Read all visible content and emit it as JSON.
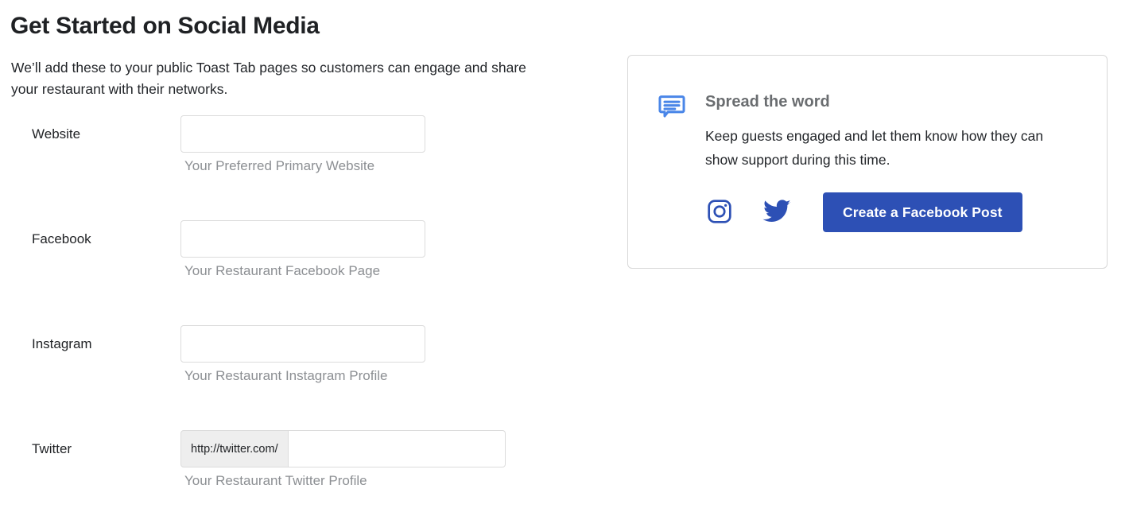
{
  "page": {
    "title": "Get Started on Social Media",
    "intro": "We’ll add these to your public Toast Tab pages so customers can engage and share your restaurant with their networks."
  },
  "form": {
    "fields": [
      {
        "label": "Website",
        "value": "",
        "placeholder": "",
        "helper": "Your Preferred Primary Website",
        "prefix": null,
        "name": "website"
      },
      {
        "label": "Facebook",
        "value": "",
        "placeholder": "",
        "helper": "Your Restaurant Facebook Page",
        "prefix": null,
        "name": "facebook"
      },
      {
        "label": "Instagram",
        "value": "",
        "placeholder": "",
        "helper": "Your Restaurant Instagram Profile",
        "prefix": null,
        "name": "instagram"
      },
      {
        "label": "Twitter",
        "value": "",
        "placeholder": "",
        "helper": "Your Restaurant Twitter Profile",
        "prefix": "http://twitter.com/",
        "name": "twitter"
      }
    ]
  },
  "promo_card": {
    "icon": "speech-bubble-icon",
    "title": "Spread the word",
    "body": "Keep guests engaged and let them know how they can show support during this time.",
    "actions": {
      "instagram_icon": "instagram-icon",
      "twitter_icon": "twitter-icon",
      "button_label": "Create a Facebook Post"
    }
  },
  "colors": {
    "brand_blue": "#2d50b5",
    "icon_blue": "#4a86e8",
    "text_dark": "#212326",
    "text_muted": "#8c8f93",
    "border": "#dcdcdc",
    "addon_bg": "#eeeeee"
  }
}
